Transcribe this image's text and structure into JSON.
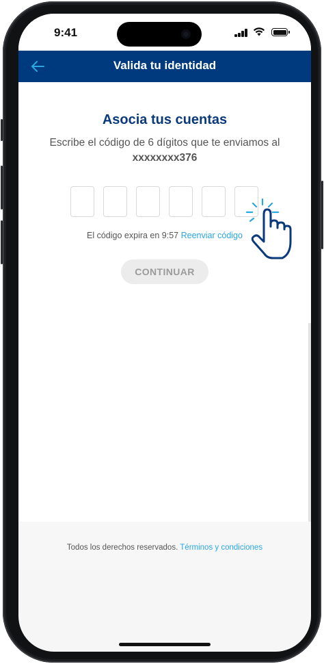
{
  "status_bar": {
    "time": "9:41"
  },
  "header": {
    "title": "Valida tu identidad",
    "back_icon": "arrow-left-icon"
  },
  "content": {
    "heading": "Asocia tus cuentas",
    "description": "Escribe el código de 6 dígitos que te enviamos al",
    "masked_number": "xxxxxxxx376",
    "code_boxes": [
      "",
      "",
      "",
      "",
      "",
      ""
    ],
    "expire_text": "El código expira en 9:57",
    "resend_link": "Reenviar código",
    "continue_button": "CONTINUAR"
  },
  "footer": {
    "text": "Todos los derechos reservados.",
    "terms_link": "Términos y condiciones"
  },
  "colors": {
    "header_bg": "#003a7e",
    "link": "#29a7e1",
    "heading": "#0a3a7a",
    "button_bg": "#ececec"
  }
}
